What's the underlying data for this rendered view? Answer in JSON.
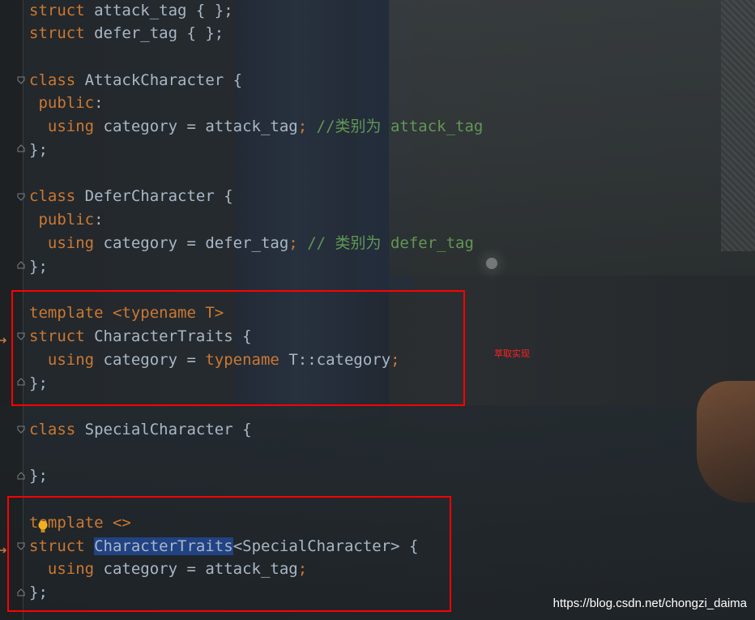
{
  "code": {
    "l1": {
      "a": "struct",
      "b": " attack_tag { };"
    },
    "l2": {
      "a": "struct",
      "b": " defer_tag { };"
    },
    "l3": {
      "a": "class",
      "b": " AttackCharacter {"
    },
    "l4": {
      "a": " public",
      "b": ":"
    },
    "l5": {
      "a": "  using",
      "b": " category = attack_tag",
      "c": ";",
      "d": " //类别为 attack_tag"
    },
    "l6": "};",
    "l7": {
      "a": "class",
      "b": " DeferCharacter {"
    },
    "l8": {
      "a": " public",
      "b": ":"
    },
    "l9": {
      "a": "  using",
      "b": " category = defer_tag",
      "c": ";",
      "d": " // 类别为 defer_tag"
    },
    "l10": "};",
    "l11": {
      "a": "template",
      "b": " <",
      "c": "typename",
      "d": " T>"
    },
    "l12": {
      "a": "struct",
      "b": " CharacterTraits {"
    },
    "l13": {
      "a": "  using",
      "b": " category = ",
      "c": "typename",
      "d": " T::category",
      "e": ";"
    },
    "l14": "};",
    "l15": {
      "a": "class",
      "b": " SpecialCharacter {"
    },
    "l16": "};",
    "l17": {
      "a": "template",
      "b": " <>"
    },
    "l18": {
      "a": "struct",
      "b": " ",
      "c": "CharacterTraits",
      "d": "<SpecialCharacter> {"
    },
    "l19": {
      "a": "  using",
      "b": " category = attack_tag",
      "c": ";"
    },
    "l20": "};"
  },
  "annotation": "萃取实现",
  "watermark": "https://blog.csdn.net/chongzi_daima",
  "colors": {
    "keyword": "#cc7832",
    "identifier": "#a9b7c6",
    "comment": "#629755",
    "selection": "#214283",
    "highlight_box": "#ff0000"
  }
}
